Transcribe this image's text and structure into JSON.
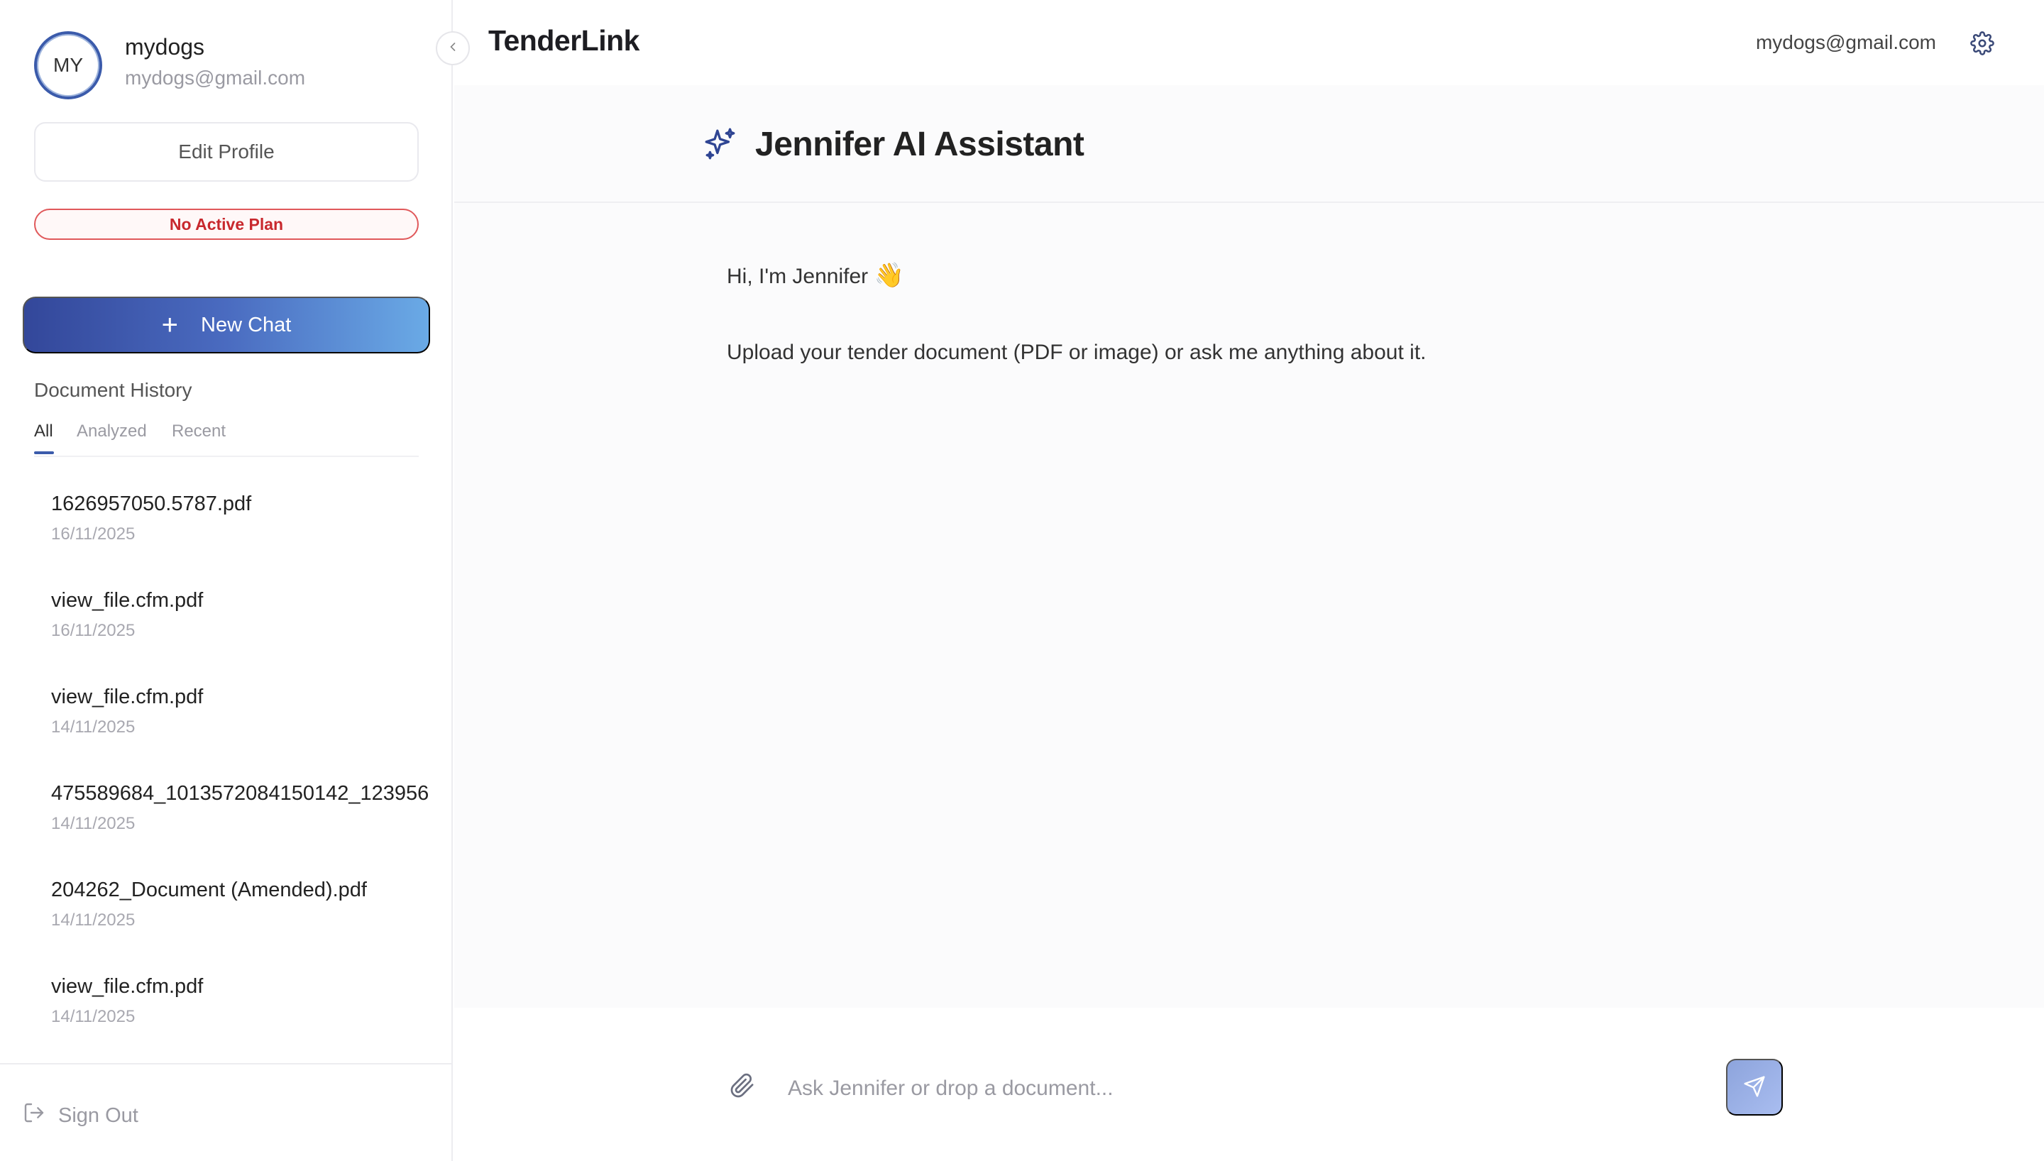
{
  "user": {
    "initials": "MY",
    "name": "mydogs",
    "email": "mydogs@gmail.com"
  },
  "sidebar": {
    "edit_profile_label": "Edit Profile",
    "plan_badge": "No Active Plan",
    "new_chat_label": "New Chat",
    "history_title": "Document History",
    "tabs": [
      {
        "label": "All",
        "active": true
      },
      {
        "label": "Analyzed",
        "active": false
      },
      {
        "label": "Recent",
        "active": false
      }
    ],
    "documents": [
      {
        "name": "1626957050.5787.pdf",
        "date": "16/11/2025"
      },
      {
        "name": "view_file.cfm.pdf",
        "date": "16/11/2025"
      },
      {
        "name": "view_file.cfm.pdf",
        "date": "14/11/2025"
      },
      {
        "name": "475589684_1013572084150142_123956",
        "date": "14/11/2025"
      },
      {
        "name": "204262_Document (Amended).pdf",
        "date": "14/11/2025"
      },
      {
        "name": "view_file.cfm.pdf",
        "date": "14/11/2025"
      }
    ],
    "sign_out_label": "Sign Out"
  },
  "header": {
    "brand": "TenderLink",
    "email": "mydogs@gmail.com"
  },
  "assistant": {
    "title": "Jennifer AI Assistant",
    "greeting": "Hi, I'm Jennifer",
    "greeting_emoji": "👋",
    "intro": "Upload your tender document (PDF or image) or ask me anything about it."
  },
  "composer": {
    "placeholder": "Ask Jennifer or drop a document...",
    "value": ""
  },
  "colors": {
    "accent": "#3b5bab",
    "gradient_start": "#33479a",
    "gradient_end": "#6aaae6",
    "danger": "#c8282d"
  },
  "icons": [
    "chevron-left-icon",
    "gear-icon",
    "sparkle-icon",
    "plus-icon",
    "sign-out-icon",
    "paperclip-icon",
    "send-icon"
  ]
}
